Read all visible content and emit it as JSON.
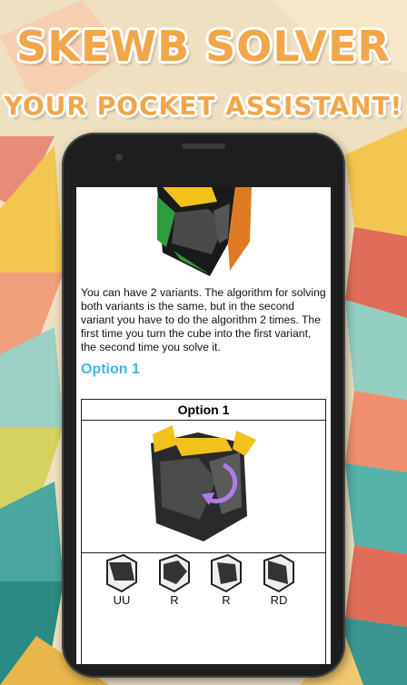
{
  "header": {
    "title": "SKEWB SOLVER",
    "subtitle": "YOUR POCKET ASSISTANT!"
  },
  "content": {
    "description": "You can have 2 variants. The algorithm for solving both variants is the same, but in the second variant you have to do the algorithm 2 times. The first time you turn the cube into the first variant, the second time you solve it.",
    "option_heading": "Option 1",
    "table": {
      "header": "Option 1",
      "moves": [
        "UU",
        "R",
        "R",
        "RD"
      ]
    }
  },
  "colors": {
    "accent_title": "#f2a64a",
    "option_heading": "#3fb6e8",
    "cube_top": "#f2c21b",
    "arrow": "#b07be8"
  }
}
